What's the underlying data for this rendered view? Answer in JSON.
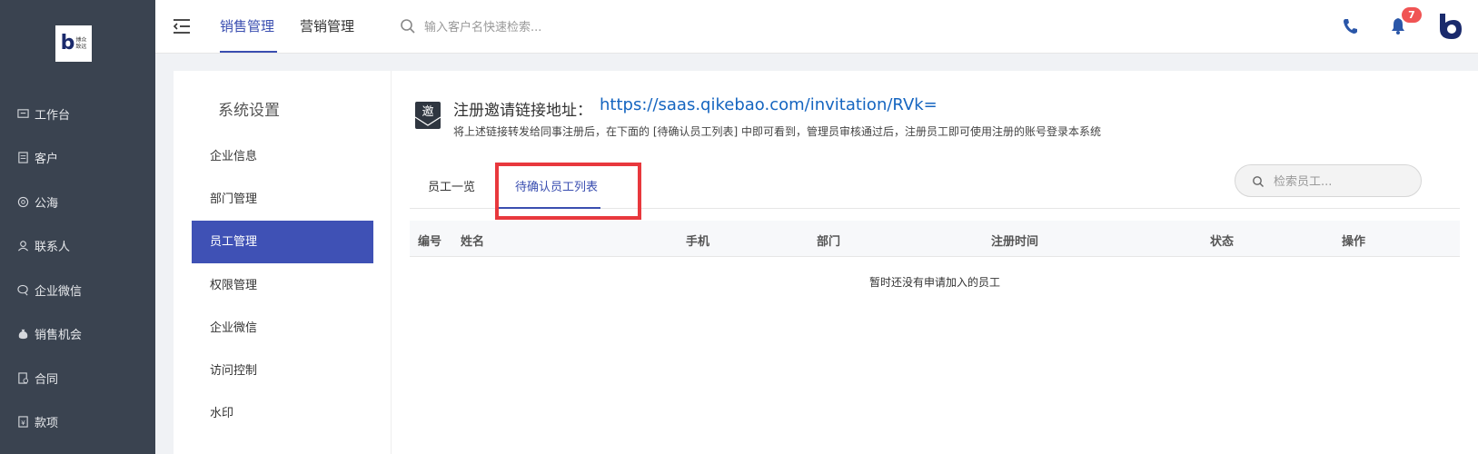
{
  "sidebar": {
    "logo": {
      "mark": "b",
      "text": "博众致远"
    },
    "items": [
      {
        "label": "工作台",
        "icon": "workbench-icon"
      },
      {
        "label": "客户",
        "icon": "customer-icon"
      },
      {
        "label": "公海",
        "icon": "public-pool-icon"
      },
      {
        "label": "联系人",
        "icon": "contact-icon"
      },
      {
        "label": "企业微信",
        "icon": "wechat-work-icon"
      },
      {
        "label": "销售机会",
        "icon": "money-bag-icon"
      },
      {
        "label": "合同",
        "icon": "contract-icon"
      },
      {
        "label": "款项",
        "icon": "payment-icon"
      }
    ]
  },
  "header": {
    "tabs": [
      {
        "label": "销售管理",
        "active": true
      },
      {
        "label": "营销管理",
        "active": false
      }
    ],
    "search_placeholder": "输入客户名快速检索...",
    "notification_count": "7",
    "accent_color": "#3a4eb0"
  },
  "settings": {
    "title": "系统设置",
    "items": [
      {
        "label": "企业信息",
        "active": false
      },
      {
        "label": "部门管理",
        "active": false
      },
      {
        "label": "员工管理",
        "active": true
      },
      {
        "label": "权限管理",
        "active": false
      },
      {
        "label": "企业微信",
        "active": false
      },
      {
        "label": "访问控制",
        "active": false
      },
      {
        "label": "水印",
        "active": false
      }
    ]
  },
  "content": {
    "invite_icon_char": "邀",
    "invite_label": "注册邀请链接地址：",
    "invite_link": "https://saas.qikebao.com/invitation/RVk=",
    "invite_desc": "将上述链接转发给同事注册后，在下面的 [待确认员工列表] 中即可看到，管理员审核通过后，注册员工即可使用注册的账号登录本系统",
    "tabs": [
      {
        "label": "员工一览",
        "active": false
      },
      {
        "label": "待确认员工列表",
        "active": true
      }
    ],
    "employee_search_placeholder": "检索员工...",
    "table": {
      "columns": [
        "编号",
        "姓名",
        "手机",
        "部门",
        "注册时间",
        "状态",
        "操作"
      ],
      "empty_text": "暂时还没有申请加入的员工"
    }
  }
}
